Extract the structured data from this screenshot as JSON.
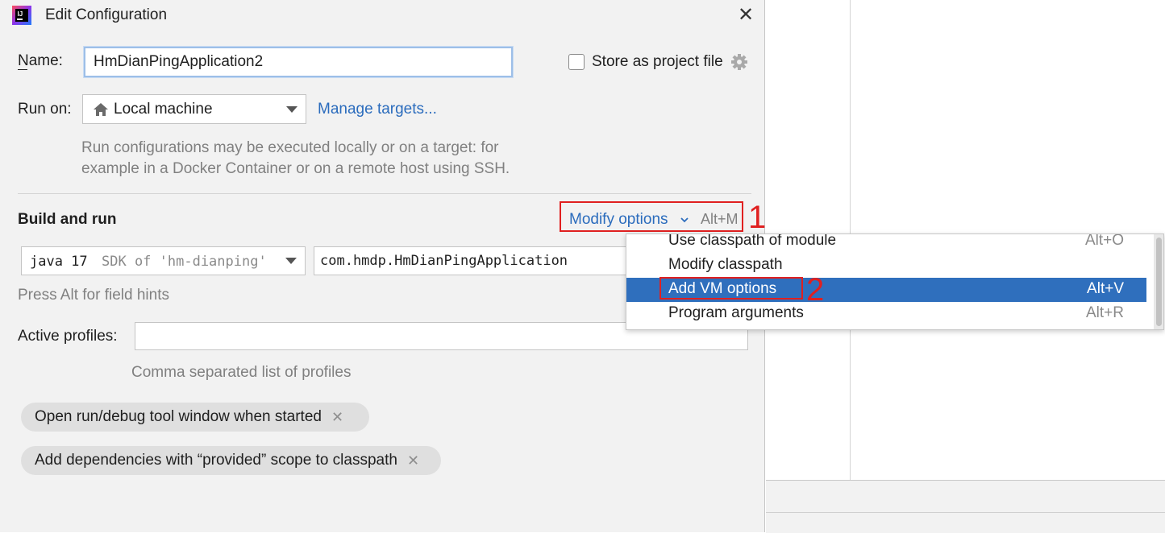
{
  "dialog": {
    "title": "Edit Configuration",
    "app_icon": "intellij-idea-icon",
    "close_icon": "close-icon"
  },
  "name_row": {
    "label": "Name:",
    "value": "HmDianPingApplication2",
    "store_label": "Store as project file",
    "store_checked": false,
    "gear_icon": "gear-icon"
  },
  "run_on": {
    "label": "Run on:",
    "value": "Local machine",
    "home_icon": "home-icon",
    "manage_link": "Manage targets...",
    "hint_line1": "Run configurations may be executed locally or on a target: for",
    "hint_line2": "example in a Docker Container or on a remote host using SSH."
  },
  "build_run": {
    "heading": "Build and run",
    "modify_options": "Modify options",
    "modify_shortcut": "Alt+M",
    "jdk_main": "java 17",
    "jdk_detail": "SDK of 'hm-dianping'",
    "main_class": "com.hmdp.HmDianPingApplication",
    "field_hint": "Press Alt for field hints"
  },
  "profiles": {
    "label": "Active profiles:",
    "value": "",
    "hint": "Comma separated list of profiles"
  },
  "chips": [
    {
      "label": "Open run/debug tool window when started"
    },
    {
      "label": "Add dependencies with “provided” scope to classpath"
    }
  ],
  "popup_menu": {
    "items": [
      {
        "label": "Use classpath of module",
        "shortcut": "Alt+O"
      },
      {
        "label": "Modify classpath",
        "shortcut": ""
      },
      {
        "label": "Add VM options",
        "shortcut": "Alt+V",
        "selected": true
      },
      {
        "label": "Program arguments",
        "shortcut": "Alt+R"
      }
    ]
  },
  "annotations": {
    "step1": "1",
    "step2": "2",
    "color": "#e02020"
  },
  "colors": {
    "link": "#2b6cbd",
    "selection": "#2f6fbd",
    "dialog_bg": "#f2f2f2"
  }
}
